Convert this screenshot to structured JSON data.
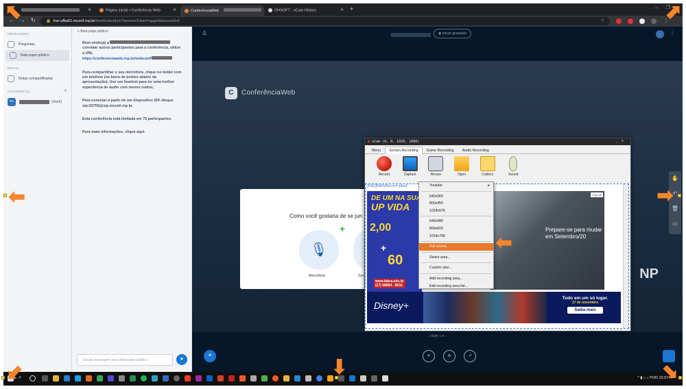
{
  "browser": {
    "tabs": [
      {
        "label": "",
        "active": false
      },
      {
        "label": "Página inicial • Conferência Web",
        "active": false
      },
      {
        "label": "ConferênciaWeb",
        "active": true
      },
      {
        "label": "OHSOFT - oCam History",
        "active": false
      }
    ],
    "new_tab": "+",
    "url_host": "live-ufba01.mconf.rnp.br",
    "url_path": "/html5client/join?sessionToken=vpgstdsdzzow3rxf"
  },
  "sidebar": {
    "messages_header": "MENSAGENS",
    "items": [
      {
        "label": "Perguntas"
      },
      {
        "label": "Bate-papo público"
      }
    ],
    "notes_header": "NOTAS",
    "notes_item": "Notas compartilhadas",
    "users_header": "USUÁRIOS (1)",
    "user_initials": "Re",
    "user_you": "(Você)"
  },
  "chat": {
    "header": "<  Bate-papo público",
    "messages": [
      "Bem-vindo(a) a",
      "convidar outros participantes para a conferência, utilize a URL",
      "https://conferenciaweb.rnp.br/webconf/",
      "Para compartilhar o seu microfone, clique no botão com um telefone (na barra de botões abaixo da apresentação). Use um headset para ter uma melhor experiência de áudio com menos ruídos.",
      "Para conectar a partir de um dispositivo SIP, disque sip:0275S@sip.mconf.rnp.br.",
      "Esta conferência está limitada em 75 participantes.",
      "Para mais informações, clique aqui."
    ],
    "composer_placeholder": "Enviar mensagem para Bate-papo público",
    "send_icon": "send-icon"
  },
  "meeting": {
    "record_label": "Iniciar gravação",
    "logo_text": "ConferênciaWeb",
    "np_text": "NP",
    "slide_label": "Slide 1",
    "audio_modal": {
      "question": "Como você gostaria de se jun",
      "mic_label": "Microfone",
      "listen_label": "Son"
    },
    "bottom_buttons": [
      "mic-off-icon",
      "video-off-icon",
      "share-screen-icon"
    ]
  },
  "ocam": {
    "title": "oCam (0, 0, 1920, 1080)",
    "tabs": [
      "Menu",
      "Screen Recording",
      "Game Recording",
      "Audio Recording"
    ],
    "active_tab": "Screen Recording",
    "toolbar": [
      {
        "label": "Record",
        "icon": "record-icon"
      },
      {
        "label": "Capture",
        "icon": "capture-icon"
      },
      {
        "label": "Resize",
        "icon": "resize-icon"
      },
      {
        "label": "Open",
        "icon": "folder-icon"
      },
      {
        "label": "Codecs",
        "icon": "codecs-icon"
      },
      {
        "label": "Sound",
        "icon": "microphone-icon"
      }
    ],
    "url_fragment": "[FAQ]WASRecord  pAud",
    "menu": {
      "groups": [
        [
          "Youtube"
        ],
        [
          "640x360",
          "800x450",
          "1024x576"
        ],
        [
          "640x480",
          "800x600",
          "1024x768"
        ],
        [
          "Full screen"
        ],
        [
          "Select area..."
        ],
        [
          "Custom size..."
        ],
        [
          "Add recording area...",
          "Edit recording area list..."
        ]
      ],
      "highlighted": "Full screen"
    },
    "ads": {
      "left_line1": "DE UM NA SUA",
      "left_line2": "UP VIDA",
      "left_price1": "2,00",
      "left_price2": "60",
      "left_footer": "www.fabra.edu.br",
      "left_phone": "(27) 98894 - 6632",
      "right_photo": "Foto do",
      "right_text": "Prepare-se para mudar em Setembro/20",
      "disney_logo": "Disney+",
      "disney_text": "Tudo em um só lugar.",
      "disney_date": "17 de novembro",
      "disney_button": "Saiba mais"
    }
  },
  "taskbar": {
    "tray_lang": "POR",
    "tray_time": "15:57"
  }
}
